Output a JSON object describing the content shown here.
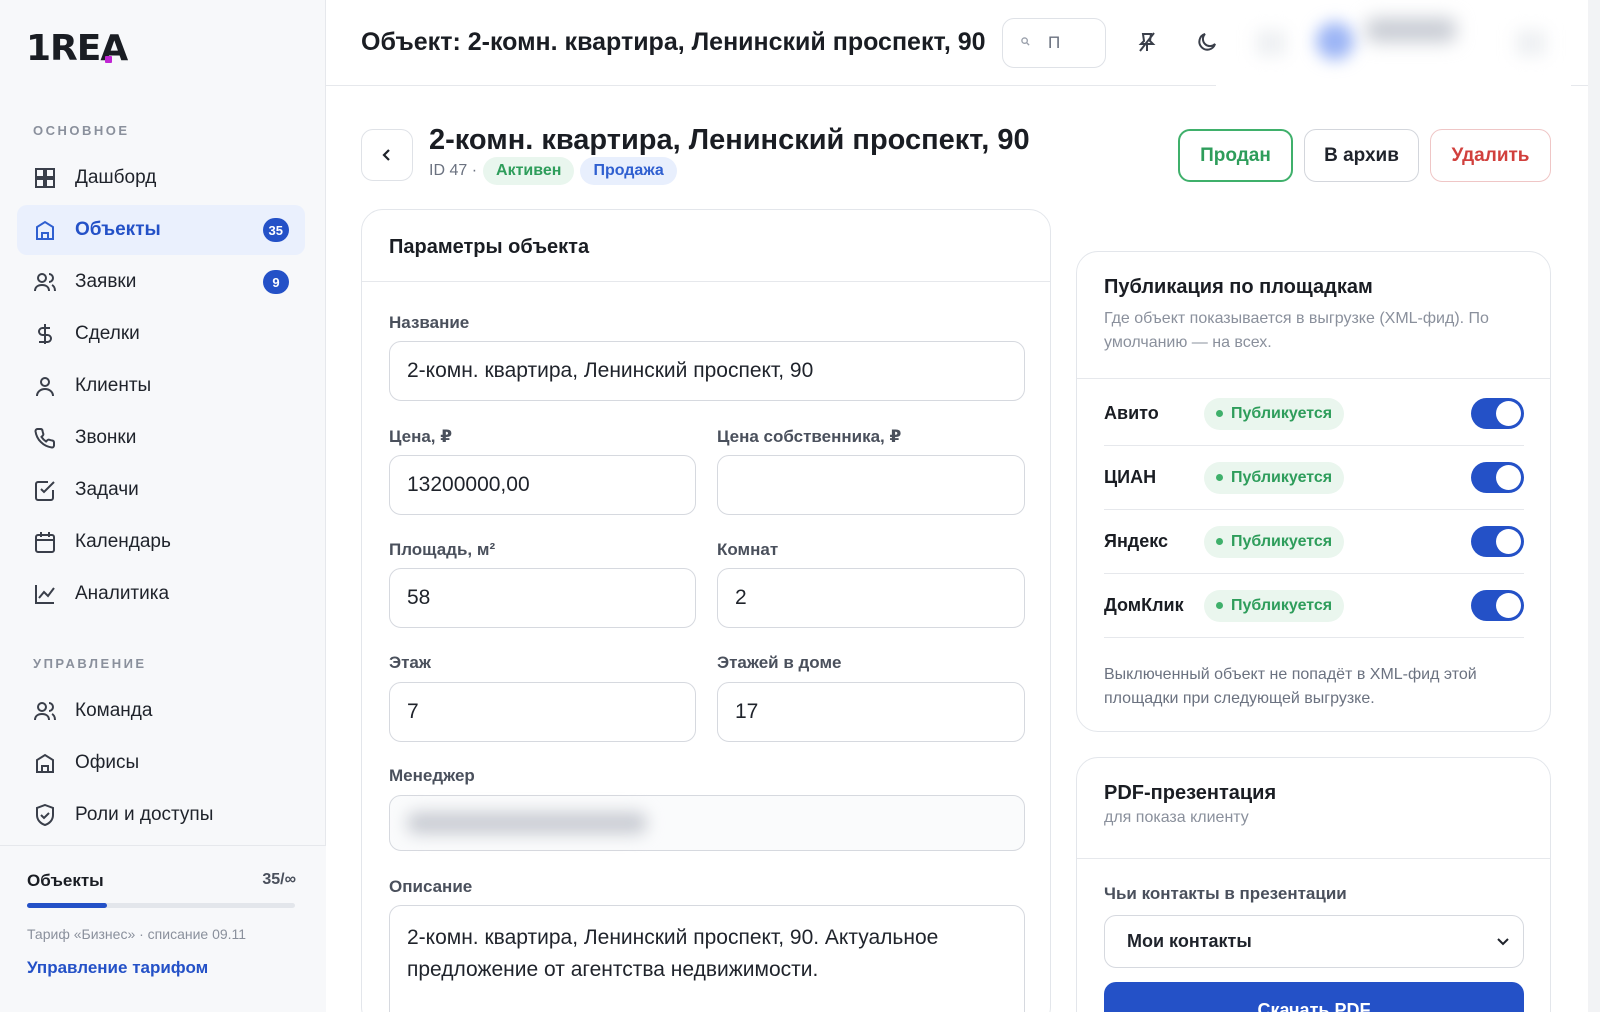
{
  "app": {
    "logo": "1REA"
  },
  "sidebar": {
    "section_main": "ОСНОВНОЕ",
    "section_manage": "УПРАВЛЕНИЕ",
    "items": [
      {
        "label": "Дашборд",
        "icon": "dashboard-icon"
      },
      {
        "label": "Объекты",
        "icon": "building-icon",
        "badge": "35",
        "active": true
      },
      {
        "label": "Заявки",
        "icon": "users-icon",
        "badge": "9"
      },
      {
        "label": "Сделки",
        "icon": "dollar-icon"
      },
      {
        "label": "Клиенты",
        "icon": "user-icon"
      },
      {
        "label": "Звонки",
        "icon": "phone-icon"
      },
      {
        "label": "Задачи",
        "icon": "checkbox-icon"
      },
      {
        "label": "Календарь",
        "icon": "calendar-icon"
      },
      {
        "label": "Аналитика",
        "icon": "chart-icon"
      }
    ],
    "manage_items": [
      {
        "label": "Команда",
        "icon": "team-icon"
      },
      {
        "label": "Офисы",
        "icon": "office-icon"
      },
      {
        "label": "Роли и доступы",
        "icon": "shield-icon"
      }
    ],
    "quota": {
      "title": "Объекты",
      "count": "35/∞",
      "progress": 0.3,
      "plan": "Тариф «Бизнес» · списание 09.11",
      "link": "Управление тарифом"
    }
  },
  "header": {
    "title": "Объект: 2-комн. квартира, Ленинский проспект, 90",
    "search_text": "П"
  },
  "page": {
    "title": "2-комн. квартира, Ленинский проспект, 90",
    "meta_id": "ID 47 ·",
    "status_tag": "Активен",
    "type_tag": "Продажа",
    "actions": {
      "sold": "Продан",
      "archive": "В архив",
      "delete": "Удалить"
    }
  },
  "params": {
    "title": "Параметры объекта",
    "name_label": "Название",
    "name_value": "2-комн. квартира, Ленинский проспект, 90",
    "price_label": "Цена, ₽",
    "price_value": "13200000,00",
    "owner_price_label": "Цена собственника, ₽",
    "owner_price_value": "",
    "area_label": "Площадь, м²",
    "area_value": "58",
    "rooms_label": "Комнат",
    "rooms_value": "2",
    "floor_label": "Этаж",
    "floor_value": "7",
    "floors_label": "Этажей в доме",
    "floors_value": "17",
    "manager_label": "Менеджер",
    "description_label": "Описание",
    "description_value": "2-комн. квартира, Ленинский проспект, 90. Актуальное предложение от агентства недвижимости."
  },
  "publication": {
    "title": "Публикация по площадкам",
    "subtitle": "Где объект показывается в выгрузке (XML-фид). По умолчанию — на всех.",
    "platforms": [
      {
        "name": "Авито",
        "status": "Публикуется",
        "enabled": true
      },
      {
        "name": "ЦИАН",
        "status": "Публикуется",
        "enabled": true
      },
      {
        "name": "Яндекс",
        "status": "Публикуется",
        "enabled": true
      },
      {
        "name": "ДомКлик",
        "status": "Публикуется",
        "enabled": true
      }
    ],
    "note": "Выключенный объект не попадёт в XML-фид этой площадки при следующей выгрузке."
  },
  "pdf": {
    "title": "PDF-презентация",
    "subtitle": "для показа клиенту",
    "contacts_label": "Чьи контакты в презентации",
    "contacts_value": "Мои контакты",
    "button": "Скачать PDF"
  }
}
